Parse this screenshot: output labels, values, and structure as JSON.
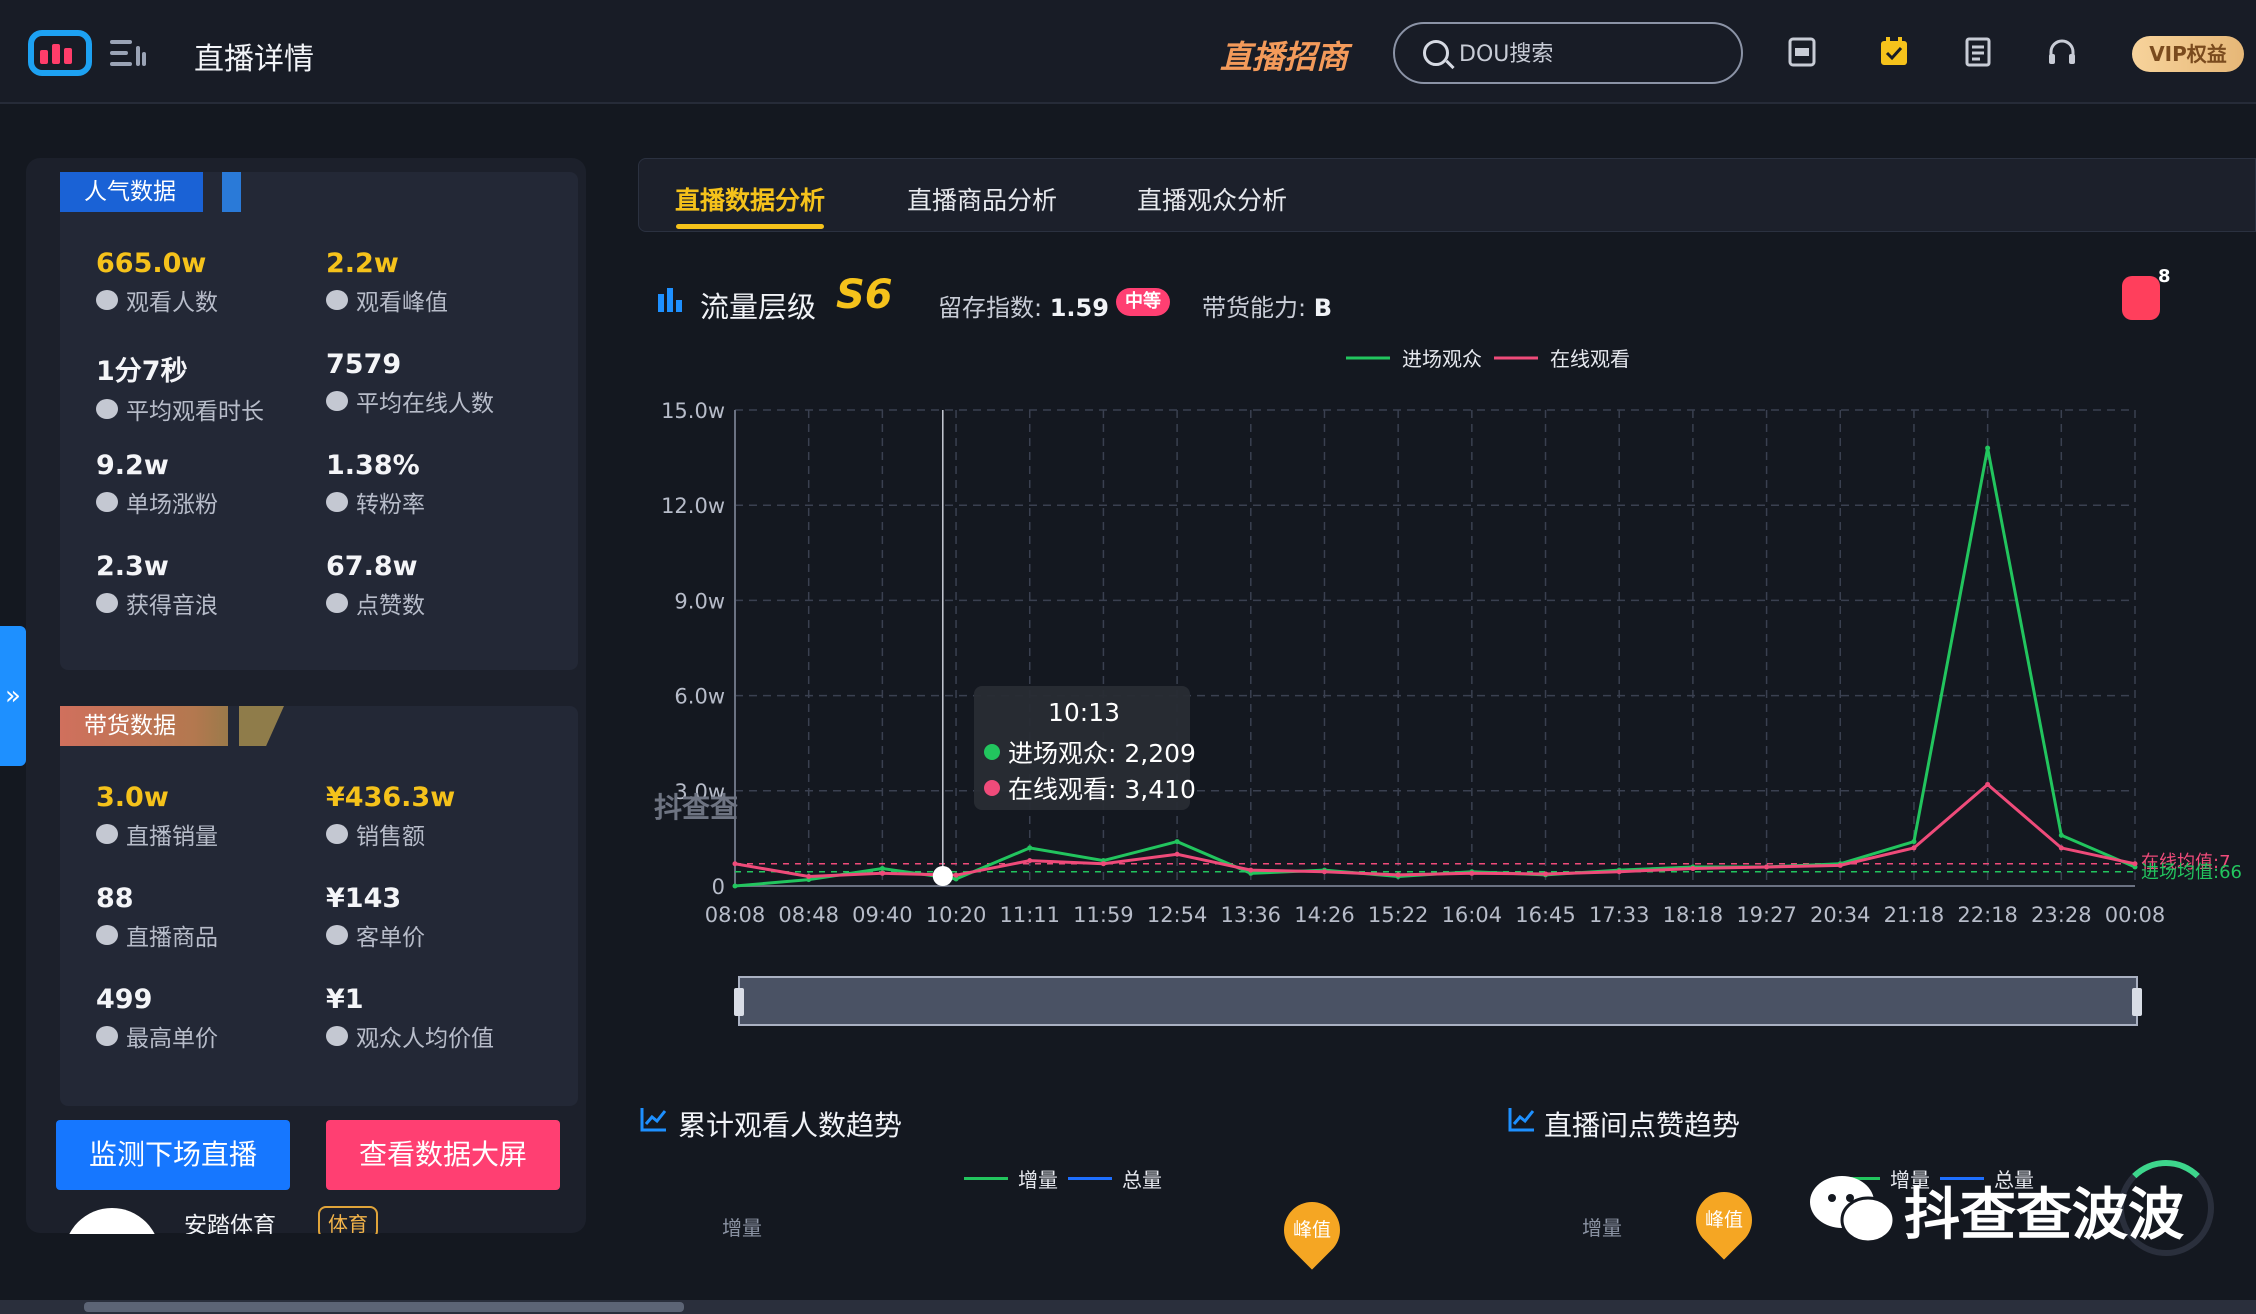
{
  "header": {
    "page_title": "直播详情",
    "promo_link": "直播招商",
    "search_placeholder": "DOU搜索",
    "vip_label": "VIP权益",
    "icons": [
      "app-icon",
      "calendar-check-icon",
      "document-icon",
      "headset-icon"
    ]
  },
  "popularity": {
    "title": "人气数据",
    "stats": [
      {
        "value": "665.0w",
        "label": "观看人数",
        "icon": "eye-icon",
        "highlight": true
      },
      {
        "value": "2.2w",
        "label": "观看峰值",
        "icon": "signal-bars-icon",
        "highlight": true
      },
      {
        "value": "1分7秒",
        "label": "平均观看时长",
        "icon": "clock-icon",
        "highlight": false
      },
      {
        "value": "7579",
        "label": "平均在线人数",
        "icon": "user-icon",
        "highlight": false
      },
      {
        "value": "9.2w",
        "label": "单场涨粉",
        "icon": "heart-plus-icon",
        "highlight": false
      },
      {
        "value": "1.38%",
        "label": "转粉率",
        "icon": "gear-badge-icon",
        "highlight": false
      },
      {
        "value": "2.3w",
        "label": "获得音浪",
        "icon": "soundwave-icon",
        "highlight": false
      },
      {
        "value": "67.8w",
        "label": "点赞数",
        "icon": "heart-icon",
        "highlight": false
      }
    ]
  },
  "sales": {
    "title": "带货数据",
    "stats": [
      {
        "value": "3.0w",
        "label": "直播销量",
        "icon": "coins-icon",
        "highlight": true
      },
      {
        "value": "¥436.3w",
        "label": "销售额",
        "icon": "yen-circle-icon",
        "highlight": true
      },
      {
        "value": "88",
        "label": "直播商品",
        "icon": "box-icon",
        "highlight": false
      },
      {
        "value": "¥143",
        "label": "客单价",
        "icon": "yen-icon",
        "highlight": false
      },
      {
        "value": "499",
        "label": "最高单价",
        "icon": "arrow-up-icon",
        "highlight": false
      },
      {
        "value": "¥1",
        "label": "观众人均价值",
        "icon": "user-yen-icon",
        "highlight": false
      }
    ]
  },
  "actions": {
    "monitor": "监测下场直播",
    "bigscreen": "查看数据大屏"
  },
  "store": {
    "name": "安踏体育",
    "tag": "体育"
  },
  "tabs": [
    {
      "label": "直播数据分析",
      "active": true
    },
    {
      "label": "直播商品分析",
      "active": false
    },
    {
      "label": "直播观众分析",
      "active": false
    }
  ],
  "traffic": {
    "label": "流量层级",
    "level": "S6",
    "retention_label": "留存指数:",
    "retention_value": "1.59",
    "retention_badge": "中等",
    "selling_label": "带货能力:",
    "selling_value": "B",
    "red_packet_count": "8"
  },
  "chart_watermark": "抖查查",
  "tooltip": {
    "time": "10:13",
    "enter_label": "进场观众: 2,209",
    "online_label": "在线观看: 3,410"
  },
  "chart_data": {
    "type": "line",
    "legend": [
      "进场观众",
      "在线观看"
    ],
    "legend_position": "top-center",
    "grid": true,
    "y_ticks": [
      "0",
      "3.0w",
      "6.0w",
      "9.0w",
      "12.0w",
      "15.0w"
    ],
    "ylim": [
      0,
      150000
    ],
    "x_ticks": [
      "08:08",
      "08:48",
      "09:40",
      "10:20",
      "11:11",
      "11:59",
      "12:54",
      "13:36",
      "14:26",
      "15:22",
      "16:04",
      "16:45",
      "17:33",
      "18:18",
      "19:27",
      "20:34",
      "21:18",
      "22:18",
      "23:28",
      "00:08"
    ],
    "avg_labels": [
      "在线均值:7",
      "进场均值:66"
    ],
    "colors": {
      "进场观众": "#22c55e",
      "在线观看": "#ef4b7a"
    },
    "series": [
      {
        "name": "进场观众",
        "values": [
          0,
          2000,
          5500,
          2209,
          12000,
          8000,
          14000,
          4000,
          5000,
          3000,
          4500,
          3500,
          5000,
          6000,
          6000,
          7000,
          14000,
          138000,
          16000,
          6000
        ]
      },
      {
        "name": "在线观看",
        "values": [
          7000,
          3000,
          4000,
          3410,
          8000,
          7000,
          10000,
          5000,
          4500,
          3500,
          4000,
          3800,
          4500,
          5500,
          6000,
          6500,
          12000,
          32000,
          12000,
          7000
        ]
      }
    ]
  },
  "sections": {
    "cumulative": {
      "title": "累计观看人数趋势",
      "legend": [
        "增量",
        "总量"
      ],
      "axis_label": "增量",
      "peak": "峰值"
    },
    "likes": {
      "title": "直播间点赞趋势",
      "legend": [
        "增量",
        "总量"
      ],
      "axis_label": "增量",
      "peak": "峰值"
    }
  },
  "wechat_watermark": "抖查查波波"
}
